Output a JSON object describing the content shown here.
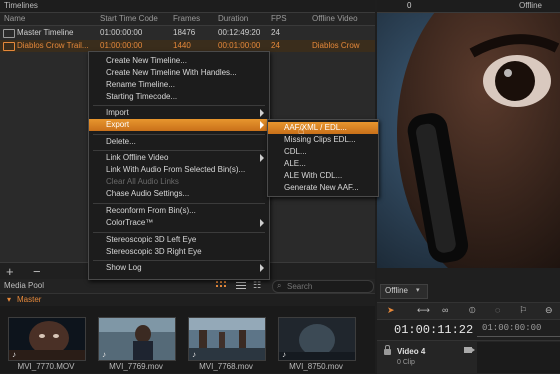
{
  "timelines": {
    "title": "Timelines",
    "columns": [
      "Name",
      "Start Time Code",
      "Frames",
      "Duration",
      "FPS",
      "Offline Video"
    ],
    "rows": [
      {
        "name": "Master Timeline",
        "start": "01:00:00:00",
        "frames": "18476",
        "duration": "00:12:49:20",
        "fps": "24",
        "offline": ""
      },
      {
        "name": "Diablos Crow Trail...",
        "start": "01:00:00:00",
        "frames": "1440",
        "duration": "00:01:00:00",
        "fps": "24",
        "offline": "Diablos Crow"
      }
    ],
    "add_label": "+",
    "remove_label": "−"
  },
  "context_menu": {
    "items": [
      {
        "label": "Create New Timeline..."
      },
      {
        "label": "Create New Timeline With Handles..."
      },
      {
        "label": "Rename Timeline..."
      },
      {
        "label": "Starting Timecode..."
      },
      {
        "label": "Import"
      },
      {
        "label": "Export"
      },
      {
        "label": "Delete..."
      },
      {
        "label": "Link Offline Video"
      },
      {
        "label": "Link With Audio From Selected Bin(s)..."
      },
      {
        "label": "Clear All Audio Links"
      },
      {
        "label": "Chase Audio Settings..."
      },
      {
        "label": "Reconform From Bin(s)..."
      },
      {
        "label": "ColorTrace™"
      },
      {
        "label": "Stereoscopic 3D Left Eye"
      },
      {
        "label": "Stereoscopic 3D Right Eye"
      },
      {
        "label": "Show Log"
      }
    ],
    "export_submenu": [
      {
        "label": "AAF/XML / EDL..."
      },
      {
        "label": "Missing Clips EDL..."
      },
      {
        "label": "CDL..."
      },
      {
        "label": "ALE..."
      },
      {
        "label": "ALE With CDL..."
      },
      {
        "label": "Generate New AAF..."
      }
    ]
  },
  "media_pool": {
    "title": "Media Pool",
    "search_placeholder": "Search",
    "bin": "Master",
    "clips": [
      {
        "name": "MVI_7770.MOV",
        "note": "♪"
      },
      {
        "name": "MVI_7769.mov",
        "note": "♪"
      },
      {
        "name": "MVI_7768.mov",
        "note": "♪"
      },
      {
        "name": "MVI_8750.mov",
        "note": "♪"
      }
    ]
  },
  "viewer": {
    "counter": "0",
    "offline_label": "Offline"
  },
  "timeline_editor": {
    "offline_select": "Offline",
    "timecode": "01:00:11:22",
    "ruler_time": "01:00:00:00",
    "track_name": "Video 4",
    "track_clips": "0 Clip"
  },
  "colors": {
    "accent": "#e5883a",
    "highlight": "#d9821f",
    "panel": "#2a2a2a"
  }
}
